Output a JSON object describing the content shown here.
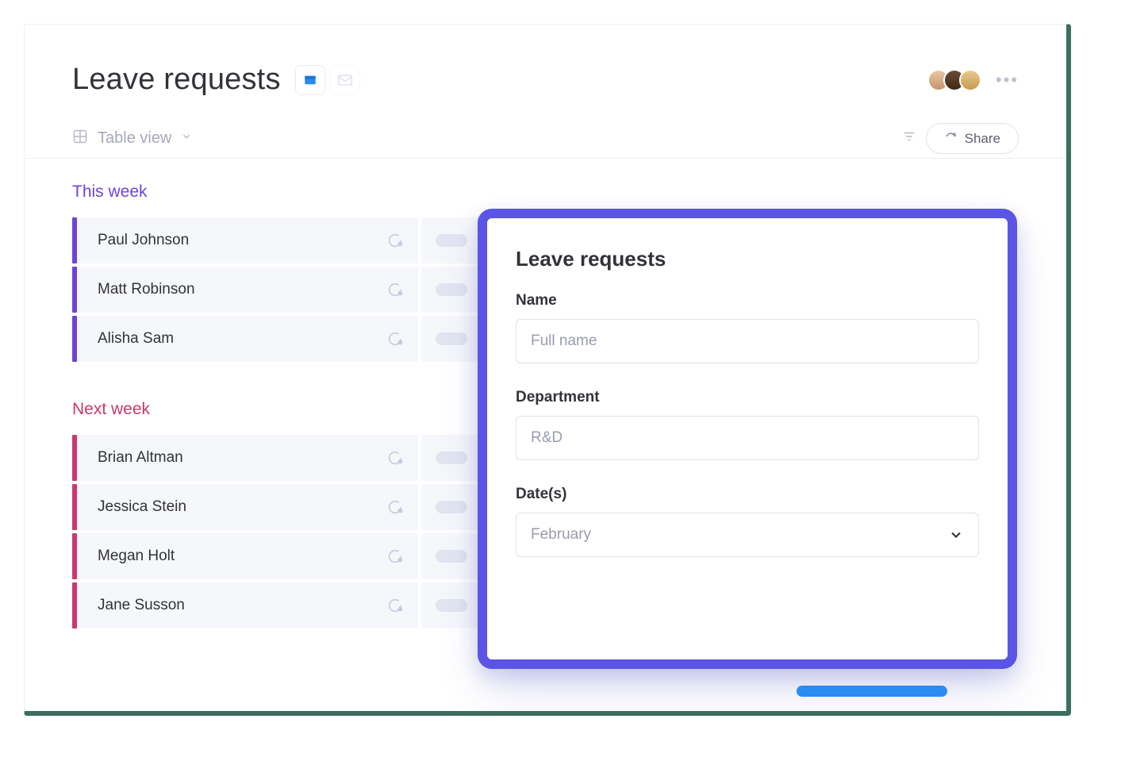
{
  "header": {
    "title": "Leave requests",
    "view_label": "Table view",
    "share_label": "Share"
  },
  "groups": [
    {
      "title": "This week",
      "color": "purple",
      "items": [
        "Paul Johnson",
        "Matt Robinson",
        "Alisha Sam"
      ]
    },
    {
      "title": "Next week",
      "color": "pink",
      "items": [
        "Brian Altman",
        "Jessica Stein",
        "Megan Holt",
        "Jane Susson"
      ]
    }
  ],
  "modal": {
    "title": "Leave requests",
    "fields": {
      "name": {
        "label": "Name",
        "placeholder": "Full name"
      },
      "department": {
        "label": "Department",
        "placeholder": "R&D"
      },
      "dates": {
        "label": "Date(s)",
        "value": "February"
      }
    }
  },
  "icons": {
    "board": "board-icon",
    "mail": "mail-icon",
    "grid": "grid-icon",
    "chevron_down": "chevron-down-icon",
    "filter": "filter-icon",
    "share": "share-icon",
    "chat": "chat-icon",
    "more": "more-icon"
  }
}
